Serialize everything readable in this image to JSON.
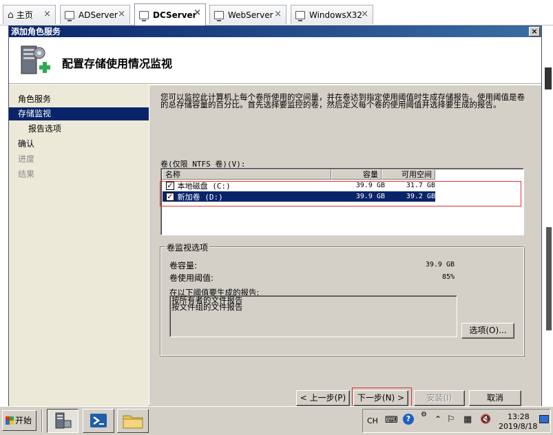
{
  "tabs": [
    {
      "label": "主页",
      "icon": "home-icon"
    },
    {
      "label": "ADServer",
      "icon": "monitor-icon"
    },
    {
      "label": "DCServer",
      "icon": "monitor-icon",
      "active": true
    },
    {
      "label": "WebServer",
      "icon": "monitor-icon"
    },
    {
      "label": "WindowsX32",
      "icon": "monitor-icon"
    }
  ],
  "window": {
    "title": "添加角色服务",
    "close_label": "×"
  },
  "header": {
    "title": "配置存储使用情况监视",
    "icon": "server-add-icon"
  },
  "nav": {
    "items": [
      {
        "label": "角色服务",
        "state": "normal"
      },
      {
        "label": "存储监视",
        "state": "selected"
      },
      {
        "label": "报告选项",
        "state": "sub"
      },
      {
        "label": "确认",
        "state": "normal"
      },
      {
        "label": "进度",
        "state": "disabled"
      },
      {
        "label": "结果",
        "state": "disabled"
      }
    ]
  },
  "content": {
    "intro": "您可以监控此计算机上每个卷所使用的空间量，并在卷达到指定使用阈值时生成存储报告。使用阈值是卷的总存储容量的百分比。首先选择要监控的卷，然后定义每个卷的使用阈值并选择要生成的报告。",
    "volumes_label": "卷(仅限 NTFS 卷)(V):",
    "columns": {
      "name": "名称",
      "capacity": "容量",
      "free": "可用空间"
    },
    "volumes": [
      {
        "name": "本地磁盘 (C:)",
        "capacity": "39.9 GB",
        "free": "31.7 GB",
        "checked": true,
        "selected": false
      },
      {
        "name": "新加卷 (D:)",
        "capacity": "39.9 GB",
        "free": "39.2 GB",
        "checked": true,
        "selected": true
      }
    ],
    "check_mark": "✓",
    "group_title": "卷监视选项",
    "capacity_label": "卷容量:",
    "capacity_value": "39.9 GB",
    "threshold_label": "卷使用阈值:",
    "threshold_value": "85%",
    "reports_label": "在以下阈值要生成的报告:",
    "reports": [
      "按所有者的文件报告",
      "按文件组的文件报告"
    ],
    "options_button": "选项(O)..."
  },
  "buttons": {
    "back": "< 上一步(P)",
    "next": "下一步(N) >",
    "install": "安装(I)",
    "cancel": "取消"
  },
  "taskbar": {
    "start_label": "开始",
    "language": "CH",
    "time": "13:28",
    "date": "2019/8/18"
  },
  "colors": {
    "selection": "#0a246a",
    "dialog_face": "#d4d0c8",
    "nav_bg": "#ece9d8",
    "highlight_box": "#e03030"
  }
}
